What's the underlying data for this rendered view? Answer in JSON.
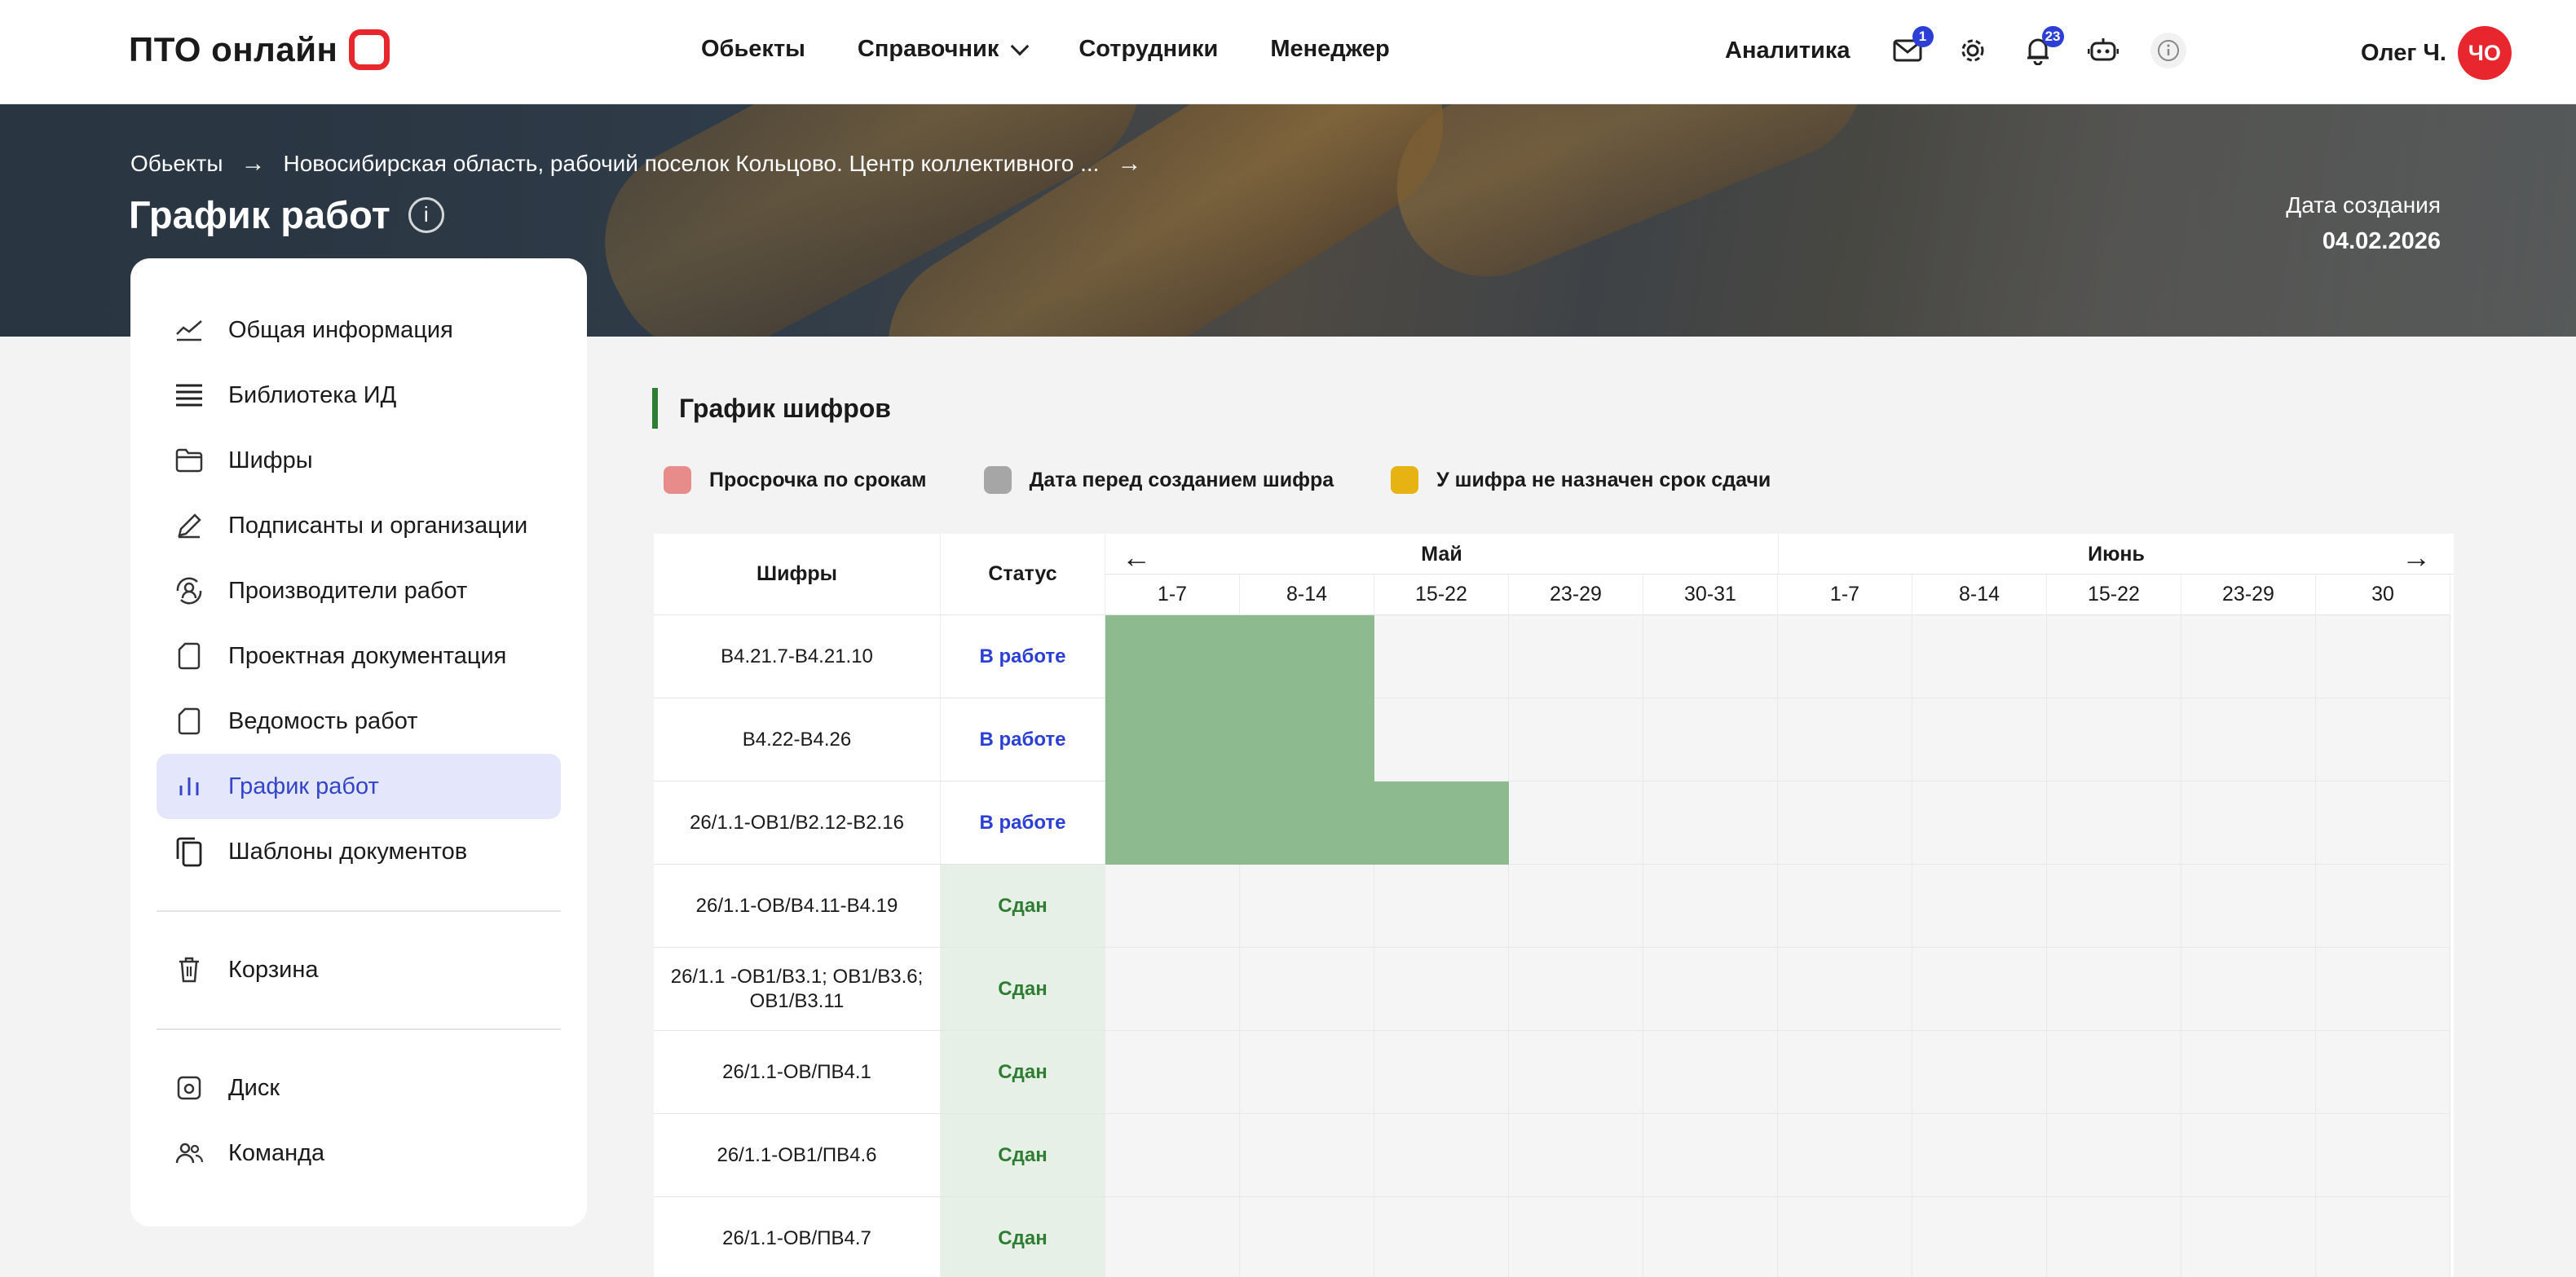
{
  "header": {
    "logo_text": "ПТО онлайн",
    "nav": [
      {
        "label": "Обьекты"
      },
      {
        "label": "Справочник",
        "has_dropdown": true
      },
      {
        "label": "Сотрудники"
      },
      {
        "label": "Менеджер"
      }
    ],
    "analytics_label": "Аналитика",
    "mail_badge": "1",
    "bell_badge": "23",
    "user_name": "Олег Ч.",
    "avatar_initials": "ЧО",
    "accent_color": "#e8262e"
  },
  "banner": {
    "breadcrumbs": [
      "Обьекты",
      "Новосибирская область, рабочий поселок Кольцово. Центр коллективного ..."
    ],
    "title": "График работ",
    "created_label": "Дата создания",
    "created_date": "04.02.2026"
  },
  "sidebar": {
    "items": [
      {
        "label": "Общая информация",
        "icon": "chart-line-icon"
      },
      {
        "label": "Библиотека ИД",
        "icon": "stack-icon"
      },
      {
        "label": "Шифры",
        "icon": "folder-icon"
      },
      {
        "label": "Подписанты и организации",
        "icon": "pen-icon"
      },
      {
        "label": "Производители работ",
        "icon": "user-cycle-icon"
      },
      {
        "label": "Проектная документация",
        "icon": "document-icon"
      },
      {
        "label": "Ведомость работ",
        "icon": "document-icon"
      },
      {
        "label": "График работ",
        "icon": "bar-chart-icon",
        "active": true
      },
      {
        "label": "Шаблоны документов",
        "icon": "copy-icon"
      }
    ],
    "bottom_items": [
      {
        "label": "Корзина",
        "icon": "trash-icon"
      },
      {
        "label": "Диск",
        "icon": "disk-icon"
      },
      {
        "label": "Команда",
        "icon": "team-icon"
      }
    ],
    "active_color": "#3344c8"
  },
  "main": {
    "section_title": "График шифров",
    "legend": [
      {
        "label": "Просрочка по срокам",
        "color": "#e88b8b"
      },
      {
        "label": "Дата перед созданием шифра",
        "color": "#a6a6a6"
      },
      {
        "label": "У шифра не назначен срок сдачи",
        "color": "#e6b312"
      }
    ],
    "table": {
      "col_code": "Шифры",
      "col_status": "Статус",
      "months": [
        "Май",
        "Июнь"
      ],
      "weeks": [
        "1-7",
        "8-14",
        "15-22",
        "23-29",
        "30-31",
        "1-7",
        "8-14",
        "15-22",
        "23-29",
        "30"
      ],
      "rows": [
        {
          "code": "В4.21.7-В4.21.10",
          "status": "В работе",
          "state": "work",
          "filled": [
            0,
            1
          ]
        },
        {
          "code": "В4.22-В4.26",
          "status": "В работе",
          "state": "work",
          "filled": [
            0,
            1
          ]
        },
        {
          "code": "26/1.1-ОВ1/В2.12-В2.16",
          "status": "В работе",
          "state": "work",
          "filled": [
            0,
            1,
            2
          ]
        },
        {
          "code": "26/1.1-ОВ/В4.11-В4.19",
          "status": "Сдан",
          "state": "done",
          "filled": []
        },
        {
          "code": "26/1.1 -ОВ1/В3.1; ОВ1/В3.6; ОВ1/В3.11",
          "status": "Сдан",
          "state": "done",
          "filled": []
        },
        {
          "code": "26/1.1-ОВ/ПВ4.1",
          "status": "Сдан",
          "state": "done",
          "filled": []
        },
        {
          "code": "26/1.1-ОВ1/ПВ4.6",
          "status": "Сдан",
          "state": "done",
          "filled": []
        },
        {
          "code": "26/1.1-ОВ/ПВ4.7",
          "status": "Сдан",
          "state": "done",
          "filled": []
        }
      ],
      "fill_color": "#8dba8e"
    }
  }
}
